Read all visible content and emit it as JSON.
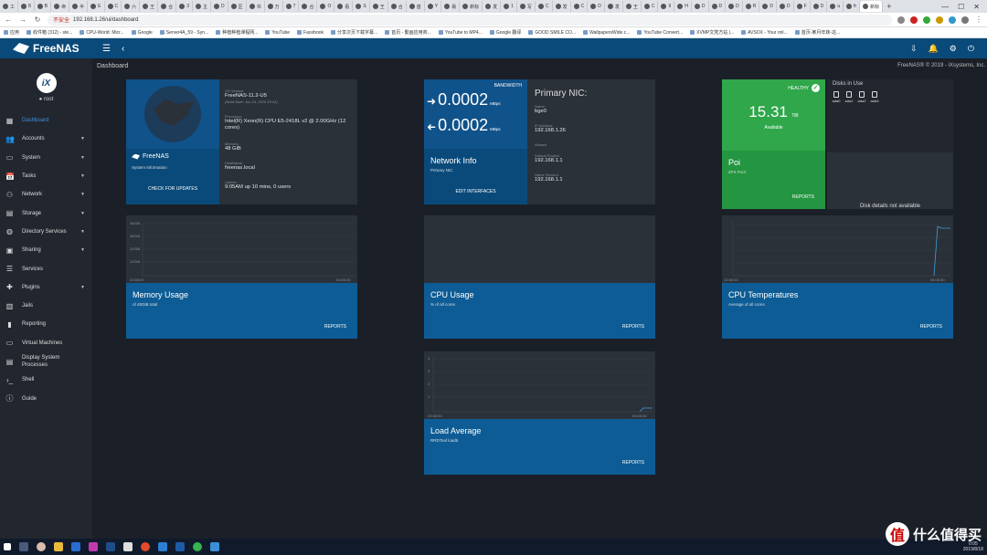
{
  "browser": {
    "tabs": [
      "工",
      "8",
      "B",
      "命",
      "半",
      "E",
      "C",
      "六",
      "王",
      "合",
      "3",
      "主",
      "D",
      "区",
      "书",
      "万",
      "7",
      "合",
      "O",
      "看",
      "S",
      "王",
      "合",
      "首",
      "Y",
      "易",
      "新标",
      "发",
      "1",
      "写",
      "C",
      "发",
      "C",
      "D",
      "发",
      "王",
      "C",
      "9",
      "H",
      "D",
      "D",
      "D",
      "R",
      "D",
      "D",
      "F",
      "D",
      "u",
      "fr",
      "新标",
      "+"
    ],
    "active_tab": "新标",
    "insecure_label": "不安全",
    "url": "192.168.1.26/ui/dashboard",
    "bookmarks": [
      "应用",
      "收件箱 (312) - ste...",
      "CPU-World: Micr...",
      "Google",
      "Server4A_59 - Syn...",
      "种植种植课程网...",
      "YouTube",
      "Facebook",
      "分享次页下载字幕...",
      "首页 - 動画应用商...",
      "YouTube to MP4...",
      "Google 翻译",
      "GOOD SMILE CO...",
      "WallpapersWide.c...",
      "YouTube Convert...",
      "XVMP文党方站 |...",
      "AVSOX - Your onl...",
      "首页-某月年妹-这..."
    ]
  },
  "header": {
    "brand": "FreeNAS"
  },
  "sidebar": {
    "user": "root",
    "logo_text": "iX",
    "items": [
      {
        "label": "Dashboard",
        "icon": "▦",
        "caret": false,
        "active": true
      },
      {
        "label": "Accounts",
        "icon": "👥",
        "caret": true
      },
      {
        "label": "System",
        "icon": "▭",
        "caret": true
      },
      {
        "label": "Tasks",
        "icon": "📅",
        "caret": true
      },
      {
        "label": "Network",
        "icon": "⚇",
        "caret": true
      },
      {
        "label": "Storage",
        "icon": "▤",
        "caret": true
      },
      {
        "label": "Directory Services",
        "icon": "◍",
        "caret": true
      },
      {
        "label": "Sharing",
        "icon": "▣",
        "caret": true
      },
      {
        "label": "Services",
        "icon": "☰",
        "caret": false
      },
      {
        "label": "Plugins",
        "icon": "✚",
        "caret": true
      },
      {
        "label": "Jails",
        "icon": "▥",
        "caret": false
      },
      {
        "label": "Reporting",
        "icon": "▮",
        "caret": false
      },
      {
        "label": "Virtual Machines",
        "icon": "▭",
        "caret": false
      },
      {
        "label": "Display System Processes",
        "icon": "▤",
        "caret": false
      },
      {
        "label": "Shell",
        "icon": "›_",
        "caret": false
      },
      {
        "label": "Guide",
        "icon": "ⓘ",
        "caret": false
      }
    ]
  },
  "main": {
    "breadcrumb": "Dashboard",
    "copyright": "FreeNAS® © 2019 - iXsystems, Inc."
  },
  "sysinfo": {
    "brand": "FreeNAS",
    "sub": "System Information",
    "check": "CHECK FOR UPDATES",
    "os_label": "OS Version:",
    "os": "FreeNAS-11.2-U5",
    "build": "(Build Date: Jun 24, 2019 18:41)",
    "proc_label": "Processor:",
    "proc": "Intel(R) Xeon(R) CPU E5-2418L v2 @ 2.00GHz (12 cores)",
    "mem_label": "Memory:",
    "mem": "48 GiB",
    "host_label": "HostName:",
    "host": "freenas.local",
    "up_label": "Uptime:",
    "up": "9:05AM up 10 mins, 0 users"
  },
  "network": {
    "bw_label": "BANDWIDTH",
    "in_val": "0.0002",
    "out_val": "0.0002",
    "unit": "MBps",
    "title": "Network Info",
    "sub": "Primary NIC",
    "edit": "EDIT INTERFACES",
    "nic_title": "Primary NIC:",
    "name_label": "Name:",
    "name": "bge0",
    "ip_label": "IP Address:",
    "ip": "192.168.1.26",
    "alias_label": "Aliases:",
    "route_label": "Default Routes:",
    "route": "192.168.1.1",
    "dns_label": "Name Servers:",
    "dns": "192.168.1.1"
  },
  "pool": {
    "status": "HEALTHY",
    "size": "15.31",
    "size_unit": "TiB",
    "avail": "Available",
    "name": "Poi",
    "sub": "ZFS Pool",
    "reports": "REPORTS",
    "disks_title": "Disks in Use",
    "disks": [
      "ada0",
      "ada1",
      "ada2",
      "ada3"
    ],
    "disk_na": "Disk details not available"
  },
  "charts": {
    "memory": {
      "title": "Memory Usage",
      "sub": "of 48GiB total",
      "reports": "REPORTS",
      "yticks": [
        "48GiB",
        "36GiB",
        "24GiB",
        "12GiB"
      ],
      "x0": "23:56:00",
      "x1": "00:05:30"
    },
    "cpu": {
      "title": "CPU Usage",
      "sub": "% of all cores",
      "reports": "REPORTS"
    },
    "temp": {
      "title": "CPU Temperatures",
      "sub": "Average of all cores",
      "reports": "REPORTS",
      "x0": "23:56:00",
      "x1": "00:05:30"
    },
    "load": {
      "title": "Load Average",
      "sub": "RRDTool load5",
      "reports": "REPORTS",
      "yticks": [
        "4",
        "3",
        "2",
        "1"
      ],
      "x0": "23:56:00",
      "x1": "00:05:30"
    }
  },
  "taskbar": {
    "time": "0:05",
    "date": "2019/8/18"
  },
  "watermark": {
    "mark": "值",
    "text": "什么值得买"
  },
  "colors": {
    "header": "#0a4a7a",
    "card_blue": "#0e5c95",
    "pool_green": "#2fa74a",
    "background": "#1b2028"
  }
}
